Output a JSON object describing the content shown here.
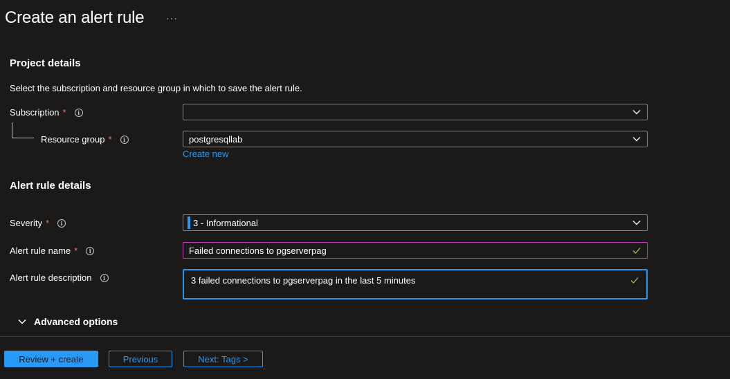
{
  "header": {
    "title": "Create an alert rule",
    "more_label": "···"
  },
  "project": {
    "section_title": "Project details",
    "description": "Select the subscription and resource group in which to save the alert rule.",
    "subscription_label": "Subscription",
    "subscription_value": "",
    "resource_group_label": "Resource group",
    "resource_group_value": "postgresqllab",
    "create_new_label": "Create new"
  },
  "alert": {
    "section_title": "Alert rule details",
    "severity_label": "Severity",
    "severity_value": "3 - Informational",
    "name_label": "Alert rule name",
    "name_value": "Failed connections to pgserverpag",
    "description_label": "Alert rule description",
    "description_value": "3 failed connections to pgserverpag in the last 5 minutes",
    "advanced_label": "Advanced options"
  },
  "common": {
    "required_mark": "*",
    "info_glyph": "i"
  },
  "footer": {
    "review_label": "Review + create",
    "previous_label": "Previous",
    "next_label": "Next: Tags >"
  },
  "colors": {
    "background": "#1b1a19",
    "accent": "#2899f5",
    "required": "#f1707b",
    "focus_purple": "#c239b3",
    "check_green": "#92c353"
  }
}
